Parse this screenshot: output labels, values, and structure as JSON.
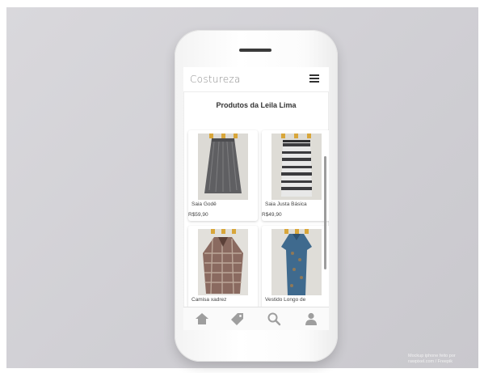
{
  "app": {
    "brand": "Costureza",
    "page_title": "Produtos da Leila Lima"
  },
  "products": [
    {
      "name": "Saia Godê",
      "price": "R$59,90"
    },
    {
      "name": "Saia Justa Básica",
      "price": "R$49,90"
    },
    {
      "name": "Camisa xadrez",
      "price": ""
    },
    {
      "name": "Vestido Longo de",
      "price": ""
    }
  ],
  "tabs": [
    {
      "icon": "home-icon"
    },
    {
      "icon": "tag-icon"
    },
    {
      "icon": "search-icon"
    },
    {
      "icon": "user-icon"
    }
  ],
  "credit": {
    "line1": "Mockup iphone feito por",
    "line2": "rawpixel.com / Freepik"
  },
  "colors": {
    "background": "#d3d2d7",
    "text": "#333333",
    "icon_gray": "#9e9e9e"
  }
}
